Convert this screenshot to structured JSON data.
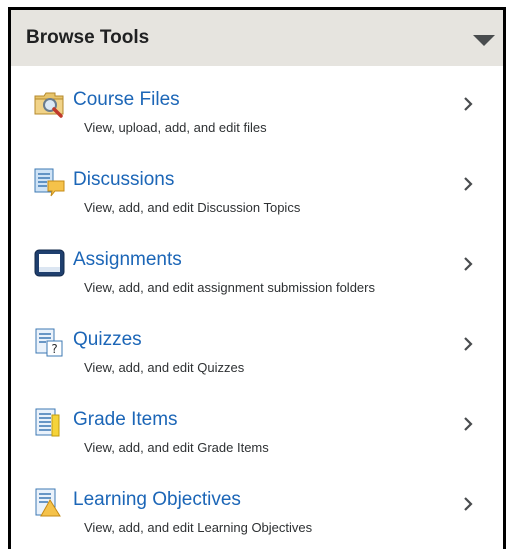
{
  "panel": {
    "title": "Browse Tools",
    "toggle_icon": "caret-down-icon"
  },
  "tools": [
    {
      "label": "Course Files",
      "description": "View, upload, add, and edit files",
      "icon": "folder-search-icon"
    },
    {
      "label": "Discussions",
      "description": "View, add, and edit Discussion Topics",
      "icon": "discussion-icon"
    },
    {
      "label": "Assignments",
      "description": "View, add, and edit assignment submission folders",
      "icon": "inbox-tray-icon"
    },
    {
      "label": "Quizzes",
      "description": "View, add, and edit Quizzes",
      "icon": "quiz-icon"
    },
    {
      "label": "Grade Items",
      "description": "View, add, and edit Grade Items",
      "icon": "gradebook-icon"
    },
    {
      "label": "Learning Objectives",
      "description": "View, add, and edit Learning Objectives",
      "icon": "learning-objectives-icon"
    }
  ],
  "colors": {
    "header_bg": "#e6e4df",
    "link": "#1c66b7",
    "text": "#2e3133"
  }
}
